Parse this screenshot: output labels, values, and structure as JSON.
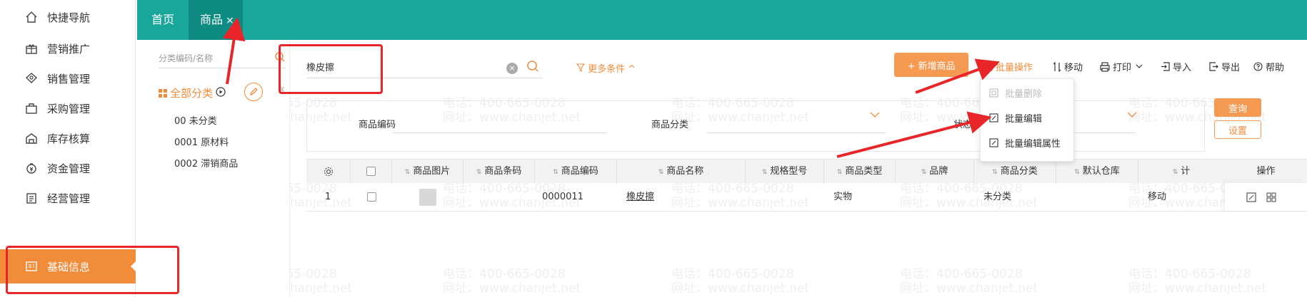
{
  "nav": {
    "items": [
      {
        "label": "快捷导航",
        "icon": "home-icon"
      },
      {
        "label": "营销推广",
        "icon": "gift-icon"
      },
      {
        "label": "销售管理",
        "icon": "sales-icon"
      },
      {
        "label": "采购管理",
        "icon": "bag-icon"
      },
      {
        "label": "库存核算",
        "icon": "warehouse-icon"
      },
      {
        "label": "资金管理",
        "icon": "money-bag-icon"
      },
      {
        "label": "经营管理",
        "icon": "clipboard-icon"
      },
      {
        "label": "基础信息",
        "icon": "id-card-icon",
        "active": true
      }
    ]
  },
  "tabs": {
    "home": "首页",
    "goods": "商品",
    "close": "×"
  },
  "category": {
    "search_placeholder": "分类编码/名称",
    "all_label": "全部分类",
    "collapse": "«",
    "items": [
      "00 未分类",
      "0001 原材料",
      "0002 滞销商品"
    ]
  },
  "toolbar": {
    "keyword": "橡皮擦",
    "clear": "×",
    "more_conditions": "更多条件 ^",
    "add_goods": "+ 新增商品",
    "batch_ops": "批量操作",
    "move": "移动",
    "print": "打印",
    "import": "导入",
    "export": "导出",
    "help": "帮助"
  },
  "filters": {
    "code_label": "商品编码",
    "category_label": "商品分类",
    "status_label": "状态",
    "query": "查询",
    "settings": "设置"
  },
  "dropdown": {
    "items": [
      {
        "label": "批量删除",
        "disabled": true
      },
      {
        "label": "批量编辑",
        "disabled": false
      },
      {
        "label": "批量编辑属性",
        "disabled": false
      }
    ]
  },
  "table": {
    "headers": [
      "商品图片",
      "商品条码",
      "商品编码",
      "商品名称",
      "规格型号",
      "商品类型",
      "品牌",
      "商品分类",
      "默认仓库",
      "计",
      "操作"
    ],
    "rows": [
      {
        "index": "1",
        "barcode": "",
        "code": "0000011",
        "name": "橡皮擦",
        "spec": "",
        "type": "实物",
        "brand": "",
        "category": "未分类",
        "warehouse": "",
        "unit": "移动"
      }
    ]
  },
  "watermark": {
    "phone": "电话：400-665-0028",
    "site": "网址：www.chanjet.net"
  },
  "colors": {
    "accent": "#f08c3a",
    "topbar": "#1aa79b",
    "annotation": "#e8262a"
  }
}
